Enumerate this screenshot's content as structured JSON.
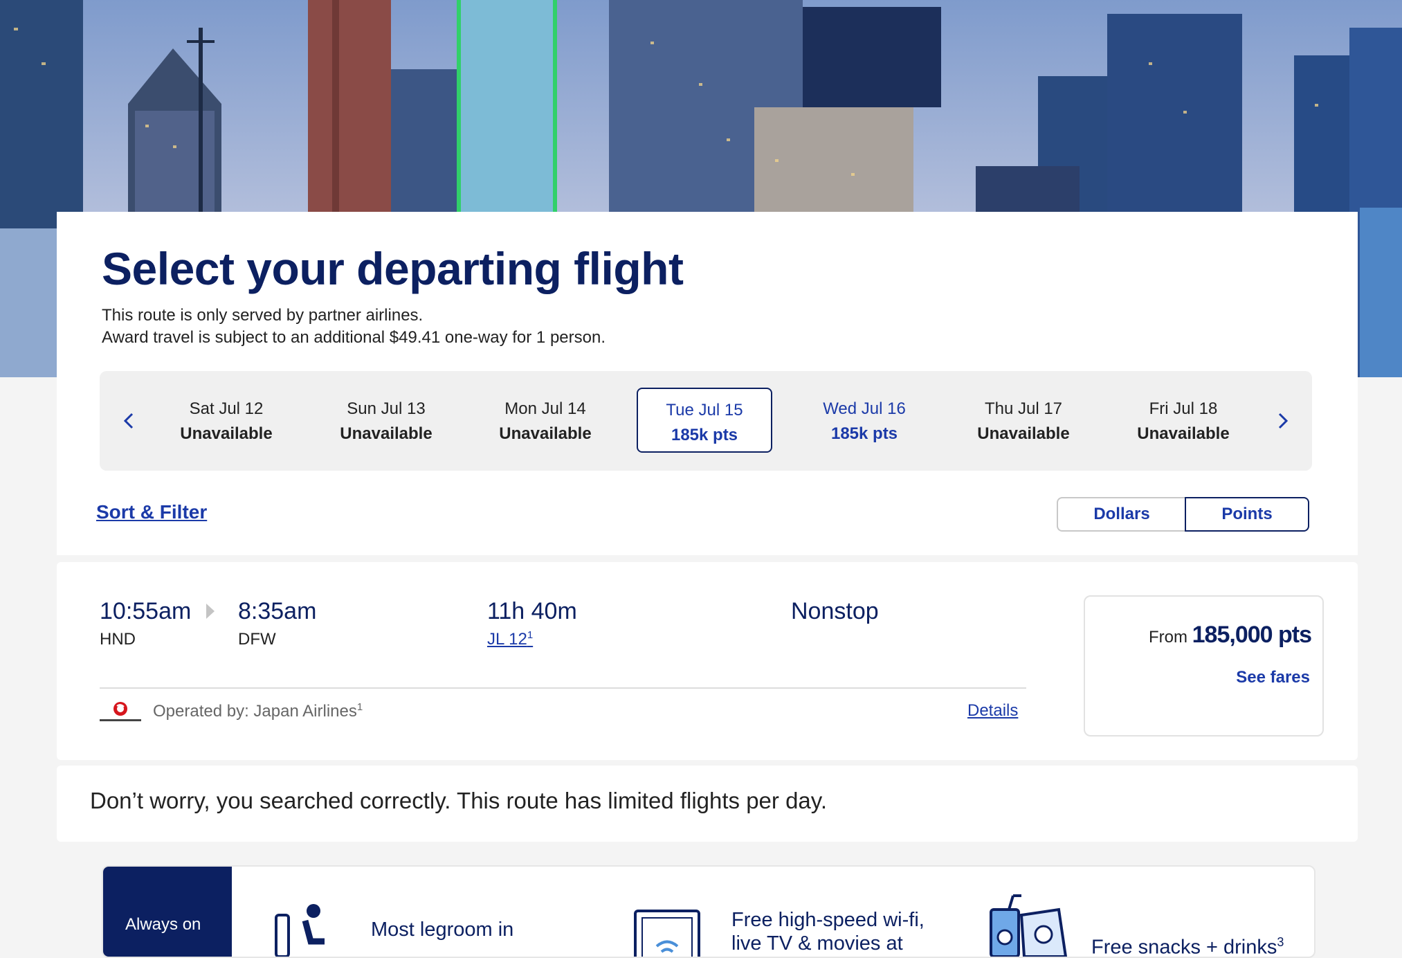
{
  "page": {
    "title": "Select your departing flight",
    "subtitle_1": "This route is only served by partner airlines.",
    "subtitle_2": "Award travel is subject to an additional $49.41 one-way for 1 person."
  },
  "dates": [
    {
      "day": "Sat Jul 12",
      "value": "Unavailable"
    },
    {
      "day": "Sun Jul 13",
      "value": "Unavailable"
    },
    {
      "day": "Mon Jul 14",
      "value": "Unavailable"
    },
    {
      "day": "Tue Jul 15",
      "value": "185k pts"
    },
    {
      "day": "Wed Jul 16",
      "value": "185k pts"
    },
    {
      "day": "Thu Jul 17",
      "value": "Unavailable"
    },
    {
      "day": "Fri Jul 18",
      "value": "Unavailable"
    }
  ],
  "controls": {
    "sort_filter": "Sort & Filter",
    "dollars": "Dollars",
    "points": "Points"
  },
  "flight": {
    "depart_time": "10:55am",
    "depart_code": "HND",
    "arrive_time": "8:35am",
    "arrive_code": "DFW",
    "duration": "11h 40m",
    "flight_number": "JL 12",
    "flight_number_note": "1",
    "stops": "Nonstop",
    "operated_by": "Operated by: Japan Airlines",
    "operated_by_note": "1",
    "details": "Details",
    "fare_from": "From",
    "fare_points": "185,000 pts",
    "see_fares": "See fares",
    "airline_logo_text": "JAPAN AIRLINES"
  },
  "notice": "Don’t worry, you searched correctly. This route has limited flights per day.",
  "promo": {
    "badge": "Always on",
    "item_1": "Most legroom in",
    "item_2_line1": "Free high-speed wi-fi,",
    "item_2_line2": "live TV & movies at",
    "item_3": "Free snacks + drinks",
    "item_3_note": "3"
  },
  "icons": {
    "prev": "chevron-left-icon",
    "next": "chevron-right-icon",
    "route_arrow": "triangle-right-icon",
    "airline_logo": "japan-airlines-logo",
    "seat": "seat-icon",
    "wifi": "wifi-tv-icon",
    "snacks": "snacks-drinks-icon"
  },
  "colors": {
    "brand_navy": "#0c2061",
    "link_blue": "#1b3aa8",
    "background": "#f4f4f4"
  }
}
